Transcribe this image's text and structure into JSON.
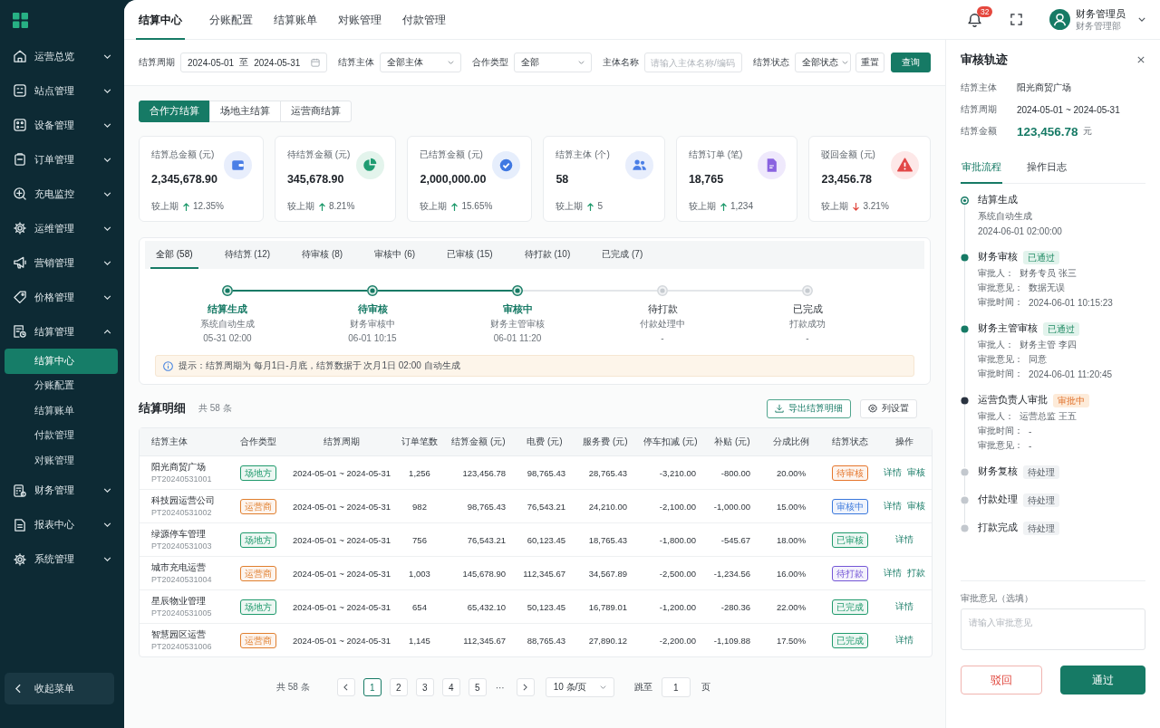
{
  "sidebar": {
    "items": [
      {
        "label": "运营总览",
        "expanded": false
      },
      {
        "label": "站点管理",
        "expanded": false
      },
      {
        "label": "设备管理",
        "expanded": false
      },
      {
        "label": "订单管理",
        "expanded": false
      },
      {
        "label": "充电监控",
        "expanded": false
      },
      {
        "label": "运维管理",
        "expanded": false
      },
      {
        "label": "营销管理",
        "expanded": false
      },
      {
        "label": "价格管理",
        "expanded": false
      },
      {
        "label": "结算管理",
        "expanded": true,
        "children": [
          {
            "label": "结算中心",
            "selected": true
          },
          {
            "label": "分账配置",
            "selected": false
          },
          {
            "label": "结算账单",
            "selected": false
          },
          {
            "label": "付款管理",
            "selected": false
          },
          {
            "label": "对账管理",
            "selected": false
          }
        ]
      },
      {
        "label": "财务管理",
        "expanded": false
      },
      {
        "label": "报表中心",
        "expanded": false
      },
      {
        "label": "系统管理",
        "expanded": false
      }
    ],
    "collapse_label": "收起菜单"
  },
  "top_tabs": [
    {
      "label": "结算中心",
      "selected": true
    },
    {
      "label": "分账配置",
      "selected": false
    },
    {
      "label": "结算账单",
      "selected": false
    },
    {
      "label": "对账管理",
      "selected": false
    },
    {
      "label": "付款管理",
      "selected": false
    }
  ],
  "header": {
    "notification_count": "32",
    "user_name": "财务管理员",
    "user_department": "财务管理部"
  },
  "filters": [
    {
      "kind": "date_range",
      "label": "结算周期",
      "start": "2024-05-01",
      "separator": "至",
      "end": "2024-05-31"
    },
    {
      "kind": "select",
      "label": "结算主体",
      "value": "全部主体"
    },
    {
      "kind": "select",
      "label": "合作类型",
      "value": "全部"
    },
    {
      "kind": "text",
      "label": "主体名称",
      "placeholder": "请输入主体名称/编码"
    },
    {
      "kind": "select",
      "label": "结算状态",
      "value": "全部状态"
    }
  ],
  "filter_buttons": [
    {
      "label": "重置",
      "kind": "reset"
    },
    {
      "label": "查询",
      "kind": "submit"
    }
  ],
  "settlement_types": [
    {
      "label": "合作方结算",
      "selected": true
    },
    {
      "label": "场地主结算",
      "selected": false
    },
    {
      "label": "运营商结算",
      "selected": false
    }
  ],
  "kpis": [
    {
      "title": "结算总金额 (元)",
      "value": "2,345,678.90",
      "compare_label": "较上期",
      "increase": true,
      "change": "12.35%"
    },
    {
      "title": "待结算金额 (元)",
      "value": "345,678.90",
      "compare_label": "较上期",
      "increase": true,
      "change": "8.21%"
    },
    {
      "title": "已结算金额 (元)",
      "value": "2,000,000.00",
      "compare_label": "较上期",
      "increase": true,
      "change": "15.65%"
    },
    {
      "title": "结算主体 (个)",
      "value": "58",
      "compare_label": "较上期",
      "increase": true,
      "change": "5"
    },
    {
      "title": "结算订单 (笔)",
      "value": "18,765",
      "compare_label": "较上期",
      "increase": true,
      "change": "1,234"
    },
    {
      "title": "驳回金额 (元)",
      "value": "23,456.78",
      "compare_label": "较上期",
      "increase": false,
      "change": "3.21%"
    }
  ],
  "status_tabs": [
    {
      "label": "全部 (58)",
      "selected": true
    },
    {
      "label": "待结算 (12)",
      "selected": false
    },
    {
      "label": "待审核 (8)",
      "selected": false
    },
    {
      "label": "审核中 (6)",
      "selected": false
    },
    {
      "label": "已审核 (15)",
      "selected": false
    },
    {
      "label": "待打款 (10)",
      "selected": false
    },
    {
      "label": "已完成 (7)",
      "selected": false
    }
  ],
  "steps": [
    {
      "title": "结算生成",
      "description": "系统自动生成",
      "time": "05-31 02:00",
      "done": true
    },
    {
      "title": "待审核",
      "description": "财务审核中",
      "time": "06-01 10:15",
      "done": true
    },
    {
      "title": "审核中",
      "description": "财务主管审核",
      "time": "06-01 11:20",
      "done": true
    },
    {
      "title": "待打款",
      "description": "付款处理中",
      "time": "-",
      "done": false
    },
    {
      "title": "已完成",
      "description": "打款成功",
      "time": "-",
      "done": false
    }
  ],
  "tip": "提示：结算周期为 每月1日-月底，结算数据于 次月1日 02:00 自动生成",
  "table_title": "结算明细",
  "table_count": "共 58 条",
  "table_actions": [
    {
      "label": "导出结算明细",
      "kind": "export"
    },
    {
      "label": "列设置",
      "kind": "settings"
    }
  ],
  "table": {
    "columns": [
      "结算主体",
      "合作类型",
      "结算周期",
      "订单笔数",
      "结算金额 (元)",
      "电费 (元)",
      "服务费 (元)",
      "停车扣减 (元)",
      "补贴 (元)",
      "分成比例",
      "结算状态",
      "操作"
    ],
    "rows": [
      {
        "entity": "阳光商贸广场",
        "code": "PT20240531001",
        "type": {
          "label": "场地方",
          "color": "#1f9a6c"
        },
        "period": "2024-05-01 ~ 2024-05-31",
        "orders": "1,256",
        "amount": "123,456.78",
        "electricity_fee": "98,765.43",
        "service_fee": "28,765.43",
        "parking_deduction": "-3,210.00",
        "subsidy": "-800.00",
        "share_ratio": "20.00%",
        "status": {
          "label": "待审核",
          "color": "#e5762c"
        },
        "actions": [
          "详情",
          "审核"
        ]
      },
      {
        "entity": "科技园运营公司",
        "code": "PT20240531002",
        "type": {
          "label": "运营商",
          "color": "#e07f2e"
        },
        "period": "2024-05-01 ~ 2024-05-31",
        "orders": "982",
        "amount": "98,765.43",
        "electricity_fee": "76,543.21",
        "service_fee": "24,210.00",
        "parking_deduction": "-2,100.00",
        "subsidy": "-1,000.00",
        "share_ratio": "15.00%",
        "status": {
          "label": "审核中",
          "color": "#3a78dc"
        },
        "actions": [
          "详情",
          "审核"
        ]
      },
      {
        "entity": "绿源停车管理",
        "code": "PT20240531003",
        "type": {
          "label": "场地方",
          "color": "#1f9a6c"
        },
        "period": "2024-05-01 ~ 2024-05-31",
        "orders": "756",
        "amount": "76,543.21",
        "electricity_fee": "60,123.45",
        "service_fee": "18,765.43",
        "parking_deduction": "-1,800.00",
        "subsidy": "-545.67",
        "share_ratio": "18.00%",
        "status": {
          "label": "已审核",
          "color": "#1f9a6c"
        },
        "actions": [
          "详情"
        ]
      },
      {
        "entity": "城市充电运营",
        "code": "PT20240531004",
        "type": {
          "label": "运营商",
          "color": "#e07f2e"
        },
        "period": "2024-05-01 ~ 2024-05-31",
        "orders": "1,003",
        "amount": "145,678.90",
        "electricity_fee": "112,345.67",
        "service_fee": "34,567.89",
        "parking_deduction": "-2,500.00",
        "subsidy": "-1,234.56",
        "share_ratio": "16.00%",
        "status": {
          "label": "待打款",
          "color": "#7456d6"
        },
        "actions": [
          "详情",
          "打款"
        ]
      },
      {
        "entity": "星辰物业管理",
        "code": "PT20240531005",
        "type": {
          "label": "场地方",
          "color": "#1f9a6c"
        },
        "period": "2024-05-01 ~ 2024-05-31",
        "orders": "654",
        "amount": "65,432.10",
        "electricity_fee": "50,123.45",
        "service_fee": "16,789.01",
        "parking_deduction": "-1,200.00",
        "subsidy": "-280.36",
        "share_ratio": "22.00%",
        "status": {
          "label": "已完成",
          "color": "#1f9a6c"
        },
        "actions": [
          "详情"
        ]
      },
      {
        "entity": "智慧园区运营",
        "code": "PT20240531006",
        "type": {
          "label": "运营商",
          "color": "#e07f2e"
        },
        "period": "2024-05-01 ~ 2024-05-31",
        "orders": "1,145",
        "amount": "112,345.67",
        "electricity_fee": "88,765.43",
        "service_fee": "27,890.12",
        "parking_deduction": "-2,200.00",
        "subsidy": "-1,109.88",
        "share_ratio": "17.50%",
        "status": {
          "label": "已完成",
          "color": "#1f9a6c"
        },
        "actions": [
          "详情"
        ]
      }
    ]
  },
  "pagination": {
    "total": "共 58 条",
    "pages": [
      {
        "label": "1",
        "selected": true
      },
      {
        "label": "2",
        "selected": false
      },
      {
        "label": "3",
        "selected": false
      },
      {
        "label": "4",
        "selected": false
      },
      {
        "label": "5",
        "selected": false
      }
    ],
    "ellipsis": "···",
    "page_size": "10 条/页",
    "jump_label": "跳至",
    "jump_value": "1",
    "page_unit": "页"
  },
  "audit_panel": {
    "title": "审核轨迹",
    "info": [
      {
        "kind": "text",
        "label": "结算主体",
        "value": "阳光商贸广场"
      },
      {
        "kind": "text",
        "label": "结算周期",
        "value": "2024-05-01 ~ 2024-05-31"
      },
      {
        "kind": "amount",
        "label": "结算金额",
        "value": "123,456.78",
        "unit": "元"
      }
    ],
    "tabs": [
      {
        "label": "审批流程",
        "selected": true
      },
      {
        "label": "操作日志",
        "selected": false
      }
    ],
    "timeline": [
      {
        "title": "结算生成",
        "kind": "generated",
        "details": [
          {
            "value": "系统自动生成"
          },
          {
            "value": "2024-06-01 02:00:00"
          }
        ]
      },
      {
        "title": "财务审核",
        "kind": "approved",
        "badge": "已通过",
        "details": [
          {
            "label": "审批人：",
            "value": "财务专员 张三"
          },
          {
            "label": "审批意见：",
            "value": "数据无误"
          },
          {
            "label": "审批时间：",
            "value": "2024-06-01 10:15:23"
          }
        ]
      },
      {
        "title": "财务主管审核",
        "kind": "approved",
        "badge": "已通过",
        "details": [
          {
            "label": "审批人：",
            "value": "财务主管 李四"
          },
          {
            "label": "审批意见：",
            "value": "同意"
          },
          {
            "label": "审批时间：",
            "value": "2024-06-01 11:20:45"
          }
        ]
      },
      {
        "title": "运营负责人审批",
        "kind": "active",
        "badge": "审批中",
        "details": [
          {
            "label": "审批人：",
            "value": "运营总监 王五"
          },
          {
            "label": "审批时间：",
            "value": "-"
          },
          {
            "label": "审批意见：",
            "value": "-"
          }
        ]
      },
      {
        "title": "财务复核",
        "kind": "pending",
        "badge": "待处理"
      },
      {
        "title": "付款处理",
        "kind": "pending",
        "badge": "待处理"
      },
      {
        "title": "打款完成",
        "kind": "pending",
        "badge": "待处理"
      }
    ],
    "comment_label": "审批意见（选填）",
    "comment_placeholder": "请输入审批意见",
    "buttons": [
      {
        "label": "驳回",
        "kind": "reject"
      },
      {
        "label": "通过",
        "kind": "approve"
      }
    ]
  }
}
